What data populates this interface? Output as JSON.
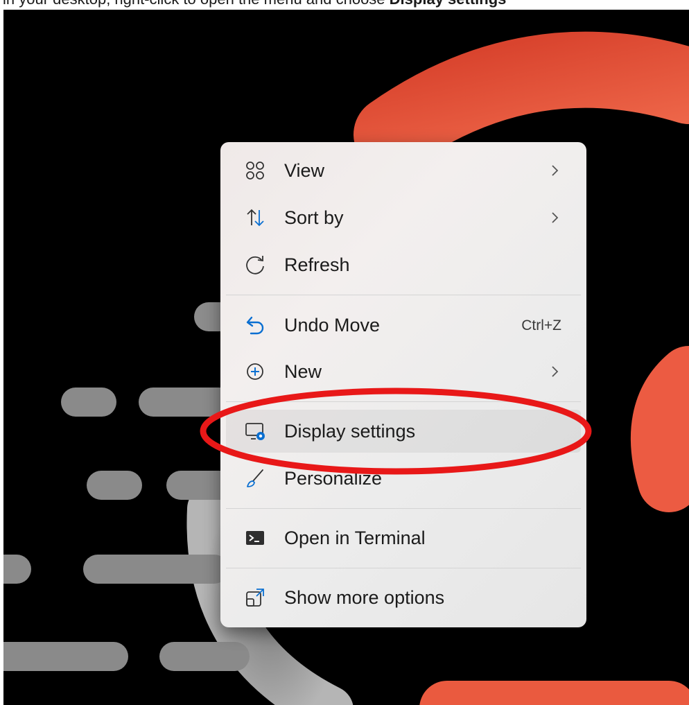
{
  "instruction": {
    "prefix": "in your desktop, right-click to open the menu and choose ",
    "emphasis": "Display settings"
  },
  "context_menu": {
    "items": [
      {
        "label": "View",
        "icon": "grid-view-icon",
        "has_submenu": true
      },
      {
        "label": "Sort by",
        "icon": "sort-arrows-icon",
        "has_submenu": true
      },
      {
        "label": "Refresh",
        "icon": "refresh-icon",
        "has_submenu": false
      },
      {
        "label": "Undo Move",
        "icon": "undo-icon",
        "shortcut": "Ctrl+Z"
      },
      {
        "label": "New",
        "icon": "add-circle-icon",
        "has_submenu": true
      },
      {
        "label": "Display settings",
        "icon": "display-settings-icon",
        "highlighted": true
      },
      {
        "label": "Personalize",
        "icon": "paintbrush-icon"
      },
      {
        "label": "Open in Terminal",
        "icon": "terminal-icon"
      },
      {
        "label": "Show more options",
        "icon": "show-more-options-icon"
      }
    ]
  },
  "colors": {
    "accent_blue": "#0a6fd1",
    "annotation_red": "#e81818",
    "wallpaper_orange": "#e5553d",
    "wallpaper_gray": "#8a8a8a"
  }
}
